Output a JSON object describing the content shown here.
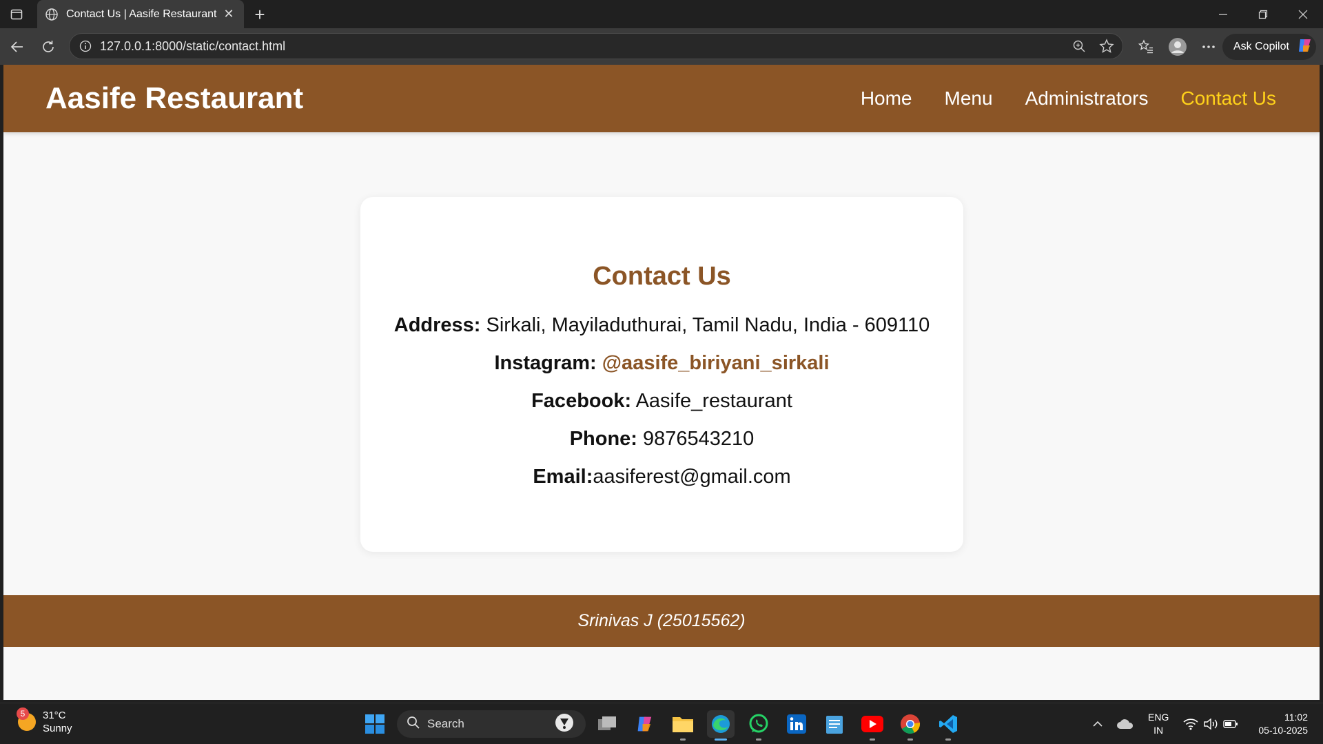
{
  "browser": {
    "tab_title": "Contact Us | Aasife Restaurant",
    "url": "127.0.0.1:8000/static/contact.html",
    "copilot_label": "Ask Copilot"
  },
  "site": {
    "logo": "Aasife Restaurant",
    "nav": [
      {
        "label": "Home"
      },
      {
        "label": "Menu"
      },
      {
        "label": "Administrators"
      },
      {
        "label": "Contact Us",
        "active": true
      }
    ],
    "accent_color": "#8b5526",
    "active_nav_color": "#ffd21a"
  },
  "contact": {
    "title": "Contact Us",
    "address_label": "Address:",
    "address_value": " Sirkali, Mayiladuthurai, Tamil Nadu, India - 609110",
    "instagram_label": "Instagram:",
    "instagram_value": "@aasife_biriyani_sirkali",
    "facebook_label": "Facebook:",
    "facebook_value": " Aasife_restaurant",
    "phone_label": "Phone:",
    "phone_value": " 9876543210",
    "email_label": "Email:",
    "email_value": "aasiferest@gmail.com"
  },
  "footer": {
    "text": "Srinivas J (25015562)"
  },
  "taskbar": {
    "weather_temp": "31°C",
    "weather_desc": "Sunny",
    "weather_badge": "5",
    "search_label": "Search",
    "lang_line1": "ENG",
    "lang_line2": "IN",
    "time": "11:02",
    "date": "05-10-2025"
  }
}
